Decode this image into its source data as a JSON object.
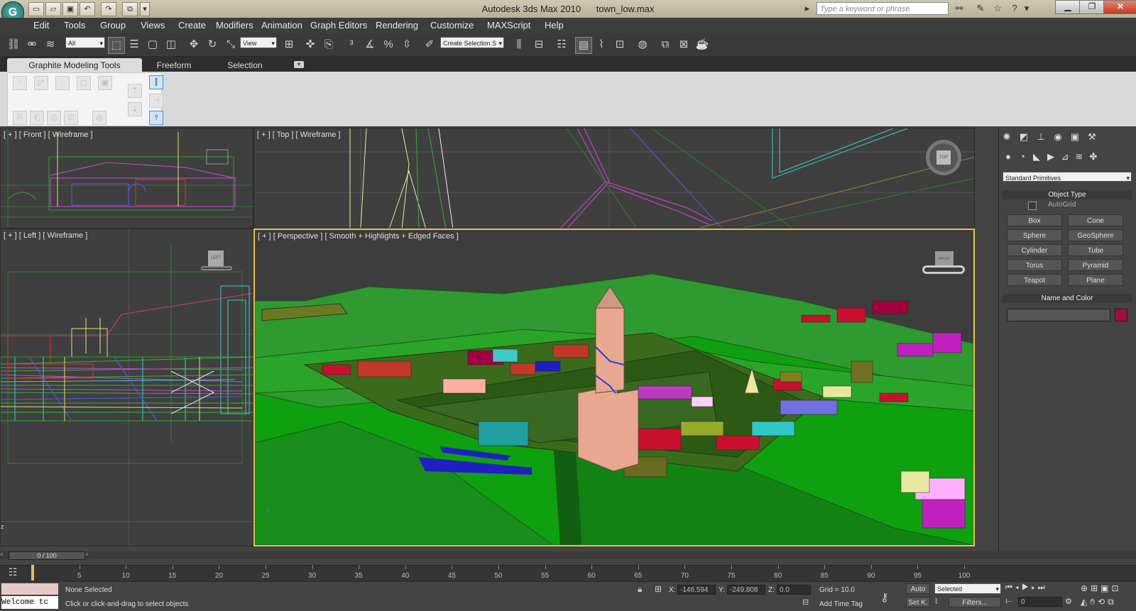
{
  "window": {
    "app_name": "Autodesk 3ds Max",
    "version": "2010",
    "file": "town_low.max",
    "search_placeholder": "Type a keyword or phrase"
  },
  "menu": [
    "Edit",
    "Tools",
    "Group",
    "Views",
    "Create",
    "Modifiers",
    "Animation",
    "Graph Editors",
    "Rendering",
    "Customize",
    "MAXScript",
    "Help"
  ],
  "toolbar": {
    "selection_filter": "All",
    "ref_coord": "View",
    "named_selection": "Create Selection S"
  },
  "ribbon": {
    "tabs": [
      "Graphite Modeling Tools",
      "Freeform",
      "Selection"
    ]
  },
  "viewports": {
    "front": "[ + ] [ Front ] [ Wireframe ]",
    "top": "[ + ] [ Top ] [ Wireframe ]",
    "left": "[ + ] [ Left ] [ Wireframe ]",
    "perspective": "[ + ] [ Perspective ] [ Smooth + Highlights + Edged Faces ]",
    "cube_top": "TOP",
    "cube_left": "LEFT",
    "cube_front": "FRONT"
  },
  "command_panel": {
    "category": "Standard Primitives",
    "object_type_header": "Object Type",
    "autogrid_label": "AutoGrid",
    "buttons": [
      "Box",
      "Cone",
      "Sphere",
      "GeoSphere",
      "Cylinder",
      "Tube",
      "Torus",
      "Pyramid",
      "Teapot",
      "Plane"
    ],
    "name_color_header": "Name and Color",
    "object_color": "#a0103c"
  },
  "timeline": {
    "frame_readout": "0 / 100",
    "ticks": [
      "5",
      "10",
      "15",
      "20",
      "25",
      "30",
      "35",
      "40",
      "45",
      "50",
      "55",
      "60",
      "65",
      "70",
      "75",
      "80",
      "85",
      "90",
      "95",
      "100"
    ]
  },
  "status": {
    "welcome": "Welcome tc",
    "selection_status": "None Selected",
    "prompt": "Click or click-and-drag to select objects",
    "x_label": "X:",
    "x_value": "-146.594",
    "y_label": "Y:",
    "y_value": "-249.808",
    "z_label": "Z:",
    "z_value": "0.0",
    "grid": "Grid = 10.0",
    "add_time_tag": "Add Time Tag",
    "auto_key": "Auto",
    "set_key": "Set K.",
    "key_filter": "Selected",
    "filters": "Filters...",
    "current_frame": "0"
  }
}
